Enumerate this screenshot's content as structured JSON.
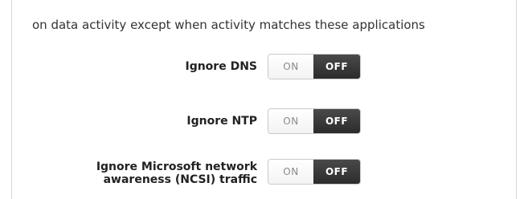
{
  "intro_text": "on data activity except when activity matches these applications",
  "settings": [
    {
      "label": "Ignore DNS",
      "on_label": "ON",
      "off_label": "OFF",
      "state": "off"
    },
    {
      "label": "Ignore NTP",
      "on_label": "ON",
      "off_label": "OFF",
      "state": "off"
    },
    {
      "label_line1": "Ignore Microsoft network",
      "label_line2": "awareness (NCSI) traffic",
      "on_label": "ON",
      "off_label": "OFF",
      "state": "off"
    }
  ]
}
